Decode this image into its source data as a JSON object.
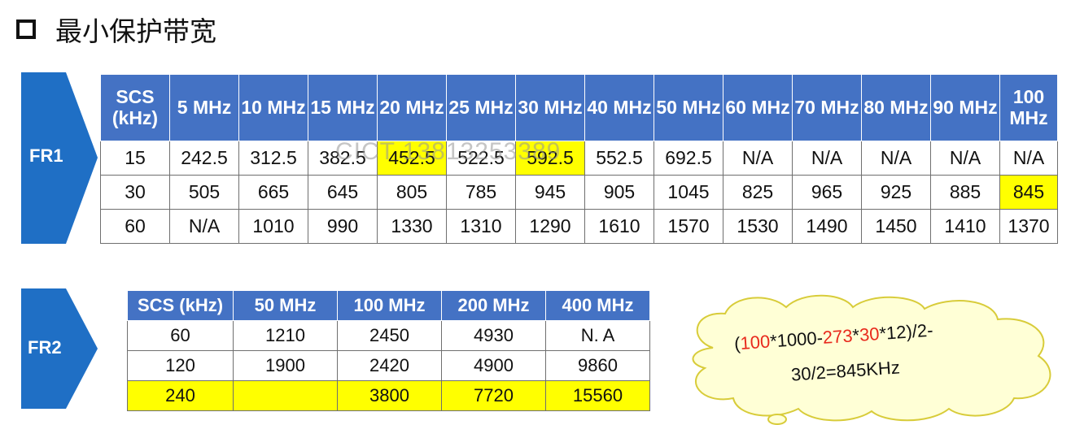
{
  "title": "最小保护带宽",
  "fr1": {
    "label": "FR1",
    "headers": [
      "SCS (kHz)",
      "5 MHz",
      "10 MHz",
      "15 MHz",
      "20 MHz",
      "25 MHz",
      "30 MHz",
      "40 MHz",
      "50 MHz",
      "60 MHz",
      "70 MHz",
      "80 MHz",
      "90 MHz",
      "100 MHz"
    ],
    "rows": [
      [
        "15",
        "242.5",
        "312.5",
        "382.5",
        "452.5",
        "522.5",
        "592.5",
        "552.5",
        "692.5",
        "N/A",
        "N/A",
        "N/A",
        "N/A",
        "N/A"
      ],
      [
        "30",
        "505",
        "665",
        "645",
        "805",
        "785",
        "945",
        "905",
        "1045",
        "825",
        "965",
        "925",
        "885",
        "845"
      ],
      [
        "60",
        "N/A",
        "1010",
        "990",
        "1330",
        "1310",
        "1290",
        "1610",
        "1570",
        "1530",
        "1490",
        "1450",
        "1410",
        "1370"
      ]
    ]
  },
  "fr2": {
    "label": "FR2",
    "headers": [
      "SCS (kHz)",
      "50 MHz",
      "100 MHz",
      "200 MHz",
      "400 MHz"
    ],
    "rows": [
      [
        "60",
        "1210",
        "2450",
        "4930",
        "N. A"
      ],
      [
        "120",
        "1900",
        "2420",
        "4900",
        "9860"
      ],
      [
        "240",
        "",
        "3800",
        "7720",
        "15560"
      ]
    ]
  },
  "formula": {
    "p1": "(",
    "p2": "100",
    "p3": "*1000-",
    "p4": "273",
    "p5": "*",
    "p6": "30",
    "p7": "*12)/2-",
    "line2": "30/2=845KHz"
  },
  "watermark": "CICT 13813253389",
  "colors": {
    "header": "#4472c4",
    "arrow": "#1f6fc5",
    "highlight": "#ffff00",
    "red": "#e8291c"
  }
}
